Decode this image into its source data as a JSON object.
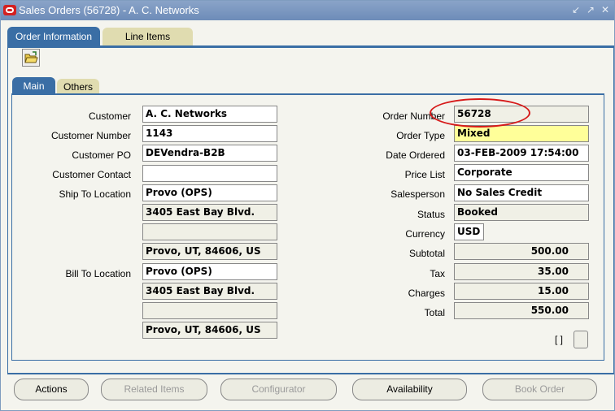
{
  "window": {
    "title": "Sales Orders (56728) - A. C. Networks"
  },
  "tabs": [
    {
      "label": "Order Information",
      "active": true
    },
    {
      "label": "Line Items",
      "active": false
    }
  ],
  "subtabs": [
    {
      "label": "Main",
      "active": true
    },
    {
      "label": "Others",
      "active": false
    }
  ],
  "left": {
    "customer": {
      "label": "Customer",
      "value": "A. C. Networks"
    },
    "customer_number": {
      "label": "Customer Number",
      "value": "1143"
    },
    "customer_po": {
      "label": "Customer PO",
      "value": "DEVendra-B2B"
    },
    "customer_contact": {
      "label": "Customer Contact",
      "value": ""
    },
    "ship_to": {
      "label": "Ship To Location",
      "lines": [
        "Provo (OPS)",
        "3405 East Bay Blvd.",
        "",
        "Provo, UT, 84606, US"
      ]
    },
    "bill_to": {
      "label": "Bill To Location",
      "lines": [
        "Provo (OPS)",
        "3405 East Bay Blvd.",
        "",
        "Provo, UT, 84606, US"
      ]
    }
  },
  "right": {
    "order_number": {
      "label": "Order Number",
      "value": "56728"
    },
    "order_type": {
      "label": "Order Type",
      "value": "Mixed"
    },
    "date_ordered": {
      "label": "Date Ordered",
      "value": "03-FEB-2009 17:54:00"
    },
    "price_list": {
      "label": "Price List",
      "value": "Corporate"
    },
    "salesperson": {
      "label": "Salesperson",
      "value": "No Sales Credit"
    },
    "status": {
      "label": "Status",
      "value": "Booked"
    },
    "currency": {
      "label": "Currency",
      "value": "USD"
    },
    "subtotal": {
      "label": "Subtotal",
      "value": "500.00"
    },
    "tax": {
      "label": "Tax",
      "value": "35.00"
    },
    "charges": {
      "label": "Charges",
      "value": "15.00"
    },
    "total": {
      "label": "Total",
      "value": "550.00"
    }
  },
  "bracket_text": "[ ]",
  "buttons": {
    "actions": "Actions",
    "related_items": "Related Items",
    "configurator": "Configurator",
    "availability": "Availability",
    "book_order": "Book Order"
  },
  "colors": {
    "title_bar": "#6d8cb8",
    "tab_active": "#3a6ea5",
    "tab_inactive": "#e0dcb0",
    "required_field": "#ffff99",
    "annotation_circle": "#d61a1a"
  },
  "icons": [
    "oracle-logo-icon",
    "folder-open-icon",
    "minimize-icon",
    "maximize-icon",
    "close-icon"
  ]
}
